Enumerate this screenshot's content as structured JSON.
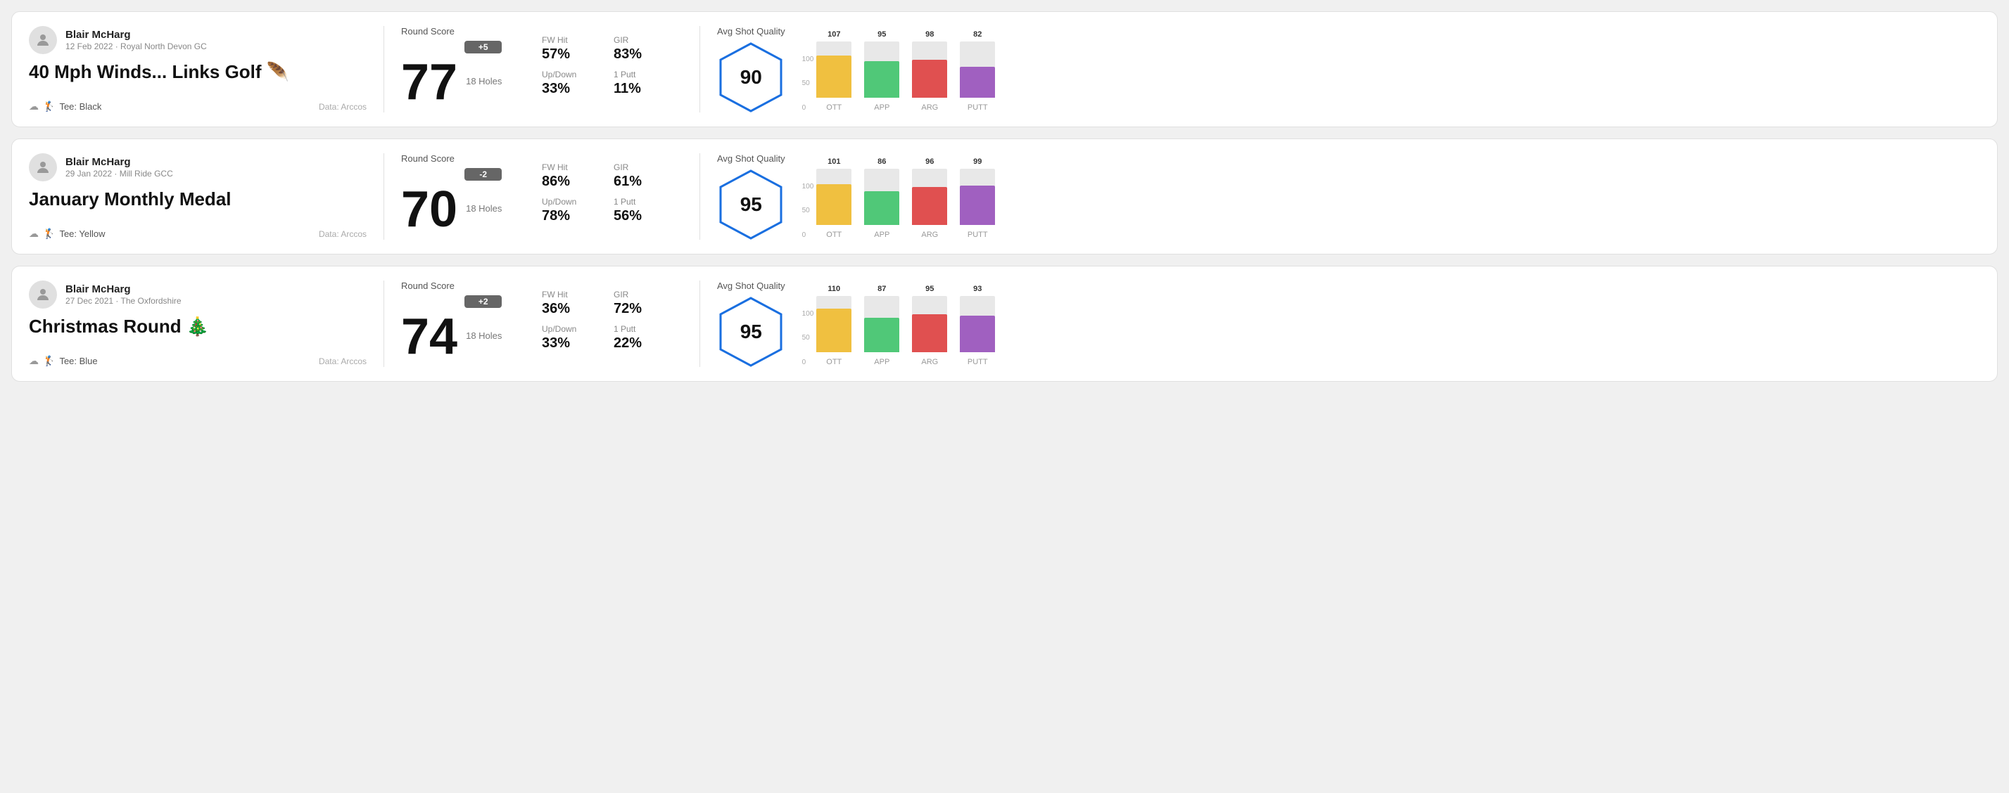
{
  "rounds": [
    {
      "id": "round1",
      "user": {
        "name": "Blair McHarg",
        "date": "12 Feb 2022",
        "course": "Royal North Devon GC"
      },
      "title": "40 Mph Winds... Links Golf 🪶",
      "tee": "Black",
      "dataSource": "Data: Arccos",
      "score": {
        "label": "Round Score",
        "number": "77",
        "badge": "+5",
        "badgeType": "positive",
        "holes": "18 Holes"
      },
      "stats": {
        "fwHit": {
          "label": "FW Hit",
          "value": "57%"
        },
        "gir": {
          "label": "GIR",
          "value": "83%"
        },
        "upDown": {
          "label": "Up/Down",
          "value": "33%"
        },
        "onePutt": {
          "label": "1 Putt",
          "value": "11%"
        }
      },
      "quality": {
        "label": "Avg Shot Quality",
        "score": "90",
        "bars": [
          {
            "label": "OTT",
            "value": 107,
            "color": "#f0c040",
            "height": 75
          },
          {
            "label": "APP",
            "value": 95,
            "color": "#50c878",
            "height": 65
          },
          {
            "label": "ARG",
            "value": 98,
            "color": "#e05050",
            "height": 68
          },
          {
            "label": "PUTT",
            "value": 82,
            "color": "#a060c0",
            "height": 55
          }
        ]
      }
    },
    {
      "id": "round2",
      "user": {
        "name": "Blair McHarg",
        "date": "29 Jan 2022",
        "course": "Mill Ride GCC"
      },
      "title": "January Monthly Medal",
      "tee": "Yellow",
      "dataSource": "Data: Arccos",
      "score": {
        "label": "Round Score",
        "number": "70",
        "badge": "-2",
        "badgeType": "negative",
        "holes": "18 Holes"
      },
      "stats": {
        "fwHit": {
          "label": "FW Hit",
          "value": "86%"
        },
        "gir": {
          "label": "GIR",
          "value": "61%"
        },
        "upDown": {
          "label": "Up/Down",
          "value": "78%"
        },
        "onePutt": {
          "label": "1 Putt",
          "value": "56%"
        }
      },
      "quality": {
        "label": "Avg Shot Quality",
        "score": "95",
        "bars": [
          {
            "label": "OTT",
            "value": 101,
            "color": "#f0c040",
            "height": 72
          },
          {
            "label": "APP",
            "value": 86,
            "color": "#50c878",
            "height": 60
          },
          {
            "label": "ARG",
            "value": 96,
            "color": "#e05050",
            "height": 67
          },
          {
            "label": "PUTT",
            "value": 99,
            "color": "#a060c0",
            "height": 70
          }
        ]
      }
    },
    {
      "id": "round3",
      "user": {
        "name": "Blair McHarg",
        "date": "27 Dec 2021",
        "course": "The Oxfordshire"
      },
      "title": "Christmas Round 🎄",
      "tee": "Blue",
      "dataSource": "Data: Arccos",
      "score": {
        "label": "Round Score",
        "number": "74",
        "badge": "+2",
        "badgeType": "positive",
        "holes": "18 Holes"
      },
      "stats": {
        "fwHit": {
          "label": "FW Hit",
          "value": "36%"
        },
        "gir": {
          "label": "GIR",
          "value": "72%"
        },
        "upDown": {
          "label": "Up/Down",
          "value": "33%"
        },
        "onePutt": {
          "label": "1 Putt",
          "value": "22%"
        }
      },
      "quality": {
        "label": "Avg Shot Quality",
        "score": "95",
        "bars": [
          {
            "label": "OTT",
            "value": 110,
            "color": "#f0c040",
            "height": 78
          },
          {
            "label": "APP",
            "value": 87,
            "color": "#50c878",
            "height": 61
          },
          {
            "label": "ARG",
            "value": 95,
            "color": "#e05050",
            "height": 67
          },
          {
            "label": "PUTT",
            "value": 93,
            "color": "#a060c0",
            "height": 65
          }
        ]
      }
    }
  ],
  "chartAxis": {
    "top": "100",
    "mid": "50",
    "bottom": "0"
  }
}
